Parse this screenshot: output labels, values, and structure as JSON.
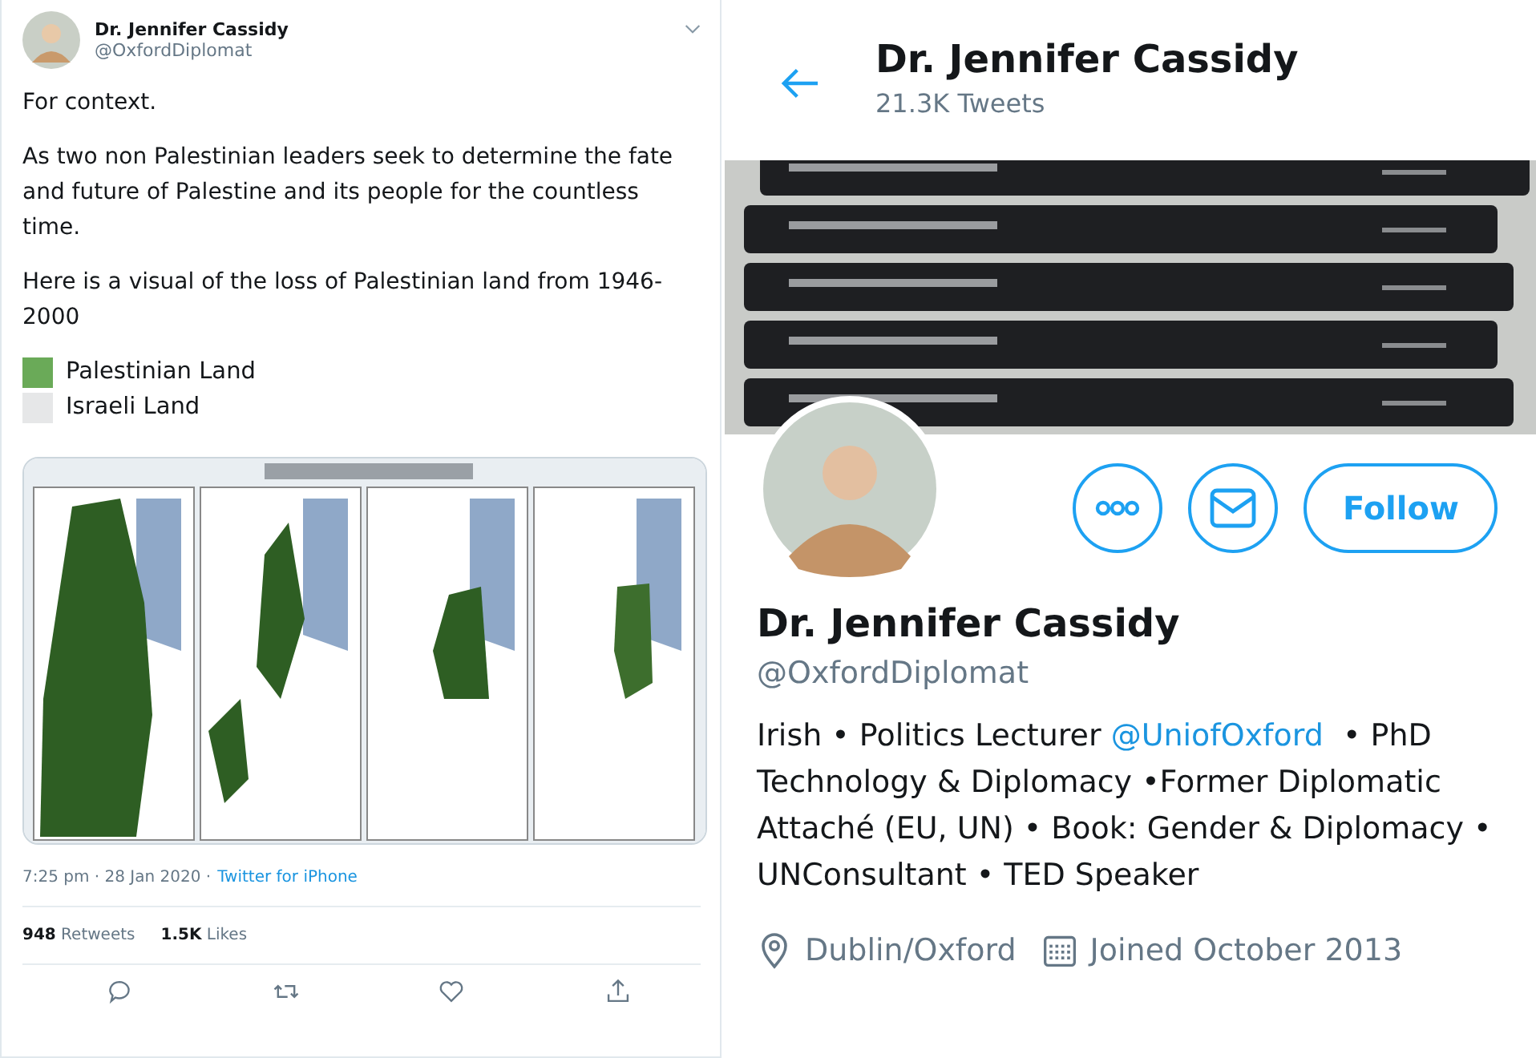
{
  "tweet": {
    "author": "Dr. Jennifer Cassidy",
    "handle": "@OxfordDiplomat",
    "paragraphs": [
      "For context.",
      "As two non Palestinian leaders seek to determine the fate and future of Palestine and its people for the countless time.",
      "Here is a visual of the loss of Palestinian land from 1946-2000"
    ],
    "legend": [
      {
        "label": "Palestinian Land",
        "color": "#6aaa58"
      },
      {
        "label": "Israeli Land",
        "color": "#e6e7e8"
      }
    ],
    "media": {
      "kind": "picture"
    },
    "timestamp": "7:25 pm · 28 Jan 2020 ·",
    "source": "Twitter for iPhone",
    "stats": [
      "**948** Retweets",
      "**1.5K** Likes"
    ]
  },
  "profile": {
    "name": "Dr. Jennifer Cassidy",
    "tweet_count": "21.3K Tweets",
    "follow_button": "Follow",
    "display_name": "Dr. Jennifer Cassidy",
    "handle": "@OxfordDiplomat",
    "bio": [
      {
        "kind": "text",
        "text": "Irish • Politics Lecturer "
      },
      {
        "kind": "link",
        "text": "@UniofOxford"
      },
      {
        "kind": "text",
        "text": "  • PhD Technology & Diplomacy •Former Diplomatic Attaché (EU, UN) • Book: Gender & Diplomacy • UNConsultant • TED Speaker"
      }
    ],
    "location": "Dublin/Oxford",
    "joined": "Joined October 2013"
  }
}
